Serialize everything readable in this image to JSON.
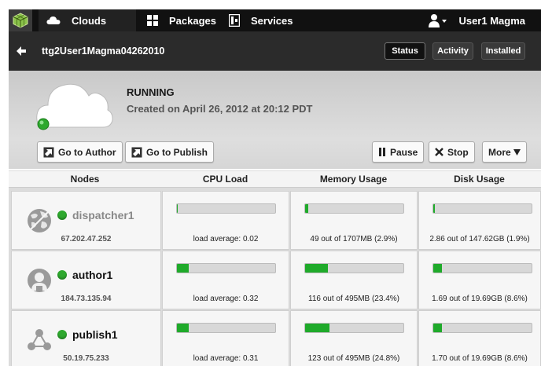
{
  "nav": {
    "tabs": [
      {
        "label": "Clouds",
        "icon": "cloud-icon"
      },
      {
        "label": "Packages",
        "icon": "grid-icon"
      },
      {
        "label": "Services",
        "icon": "services-icon"
      }
    ],
    "user": {
      "label": "User1 Magma",
      "icon": "user-icon"
    }
  },
  "instance": {
    "name": "ttg2User1Magma04262010",
    "views": [
      "Status",
      "Activity",
      "Installed"
    ],
    "active_view": "Status"
  },
  "status": {
    "state": "RUNNING",
    "created": "Created on April 26, 2012 at 20:12 PDT",
    "indicator_color": "#2ea82e"
  },
  "actions": {
    "go_author": "Go to Author",
    "go_publish": "Go to Publish",
    "pause": "Pause",
    "stop": "Stop",
    "more": "More"
  },
  "table": {
    "headers": [
      "Nodes",
      "CPU Load",
      "Memory Usage",
      "Disk Usage"
    ],
    "rows": [
      {
        "name": "dispatcher1",
        "ip": "67.202.47.252",
        "icon": "globe-icon",
        "cpu": "load average: 0.02",
        "cpu_pct": 1,
        "memory": "49 out of 1707MB (2.9%)",
        "mem_pct": 2.9,
        "disk": "2.86 out of 147.62GB (1.9%)",
        "disk_pct": 1.9
      },
      {
        "name": "author1",
        "ip": "184.73.135.94",
        "icon": "author-icon",
        "cpu": "load average: 0.32",
        "cpu_pct": 12,
        "memory": "116 out of 495MB (23.4%)",
        "mem_pct": 23.4,
        "disk": "1.69 out of 19.69GB (8.6%)",
        "disk_pct": 8.6
      },
      {
        "name": "publish1",
        "ip": "50.19.75.233",
        "icon": "network-icon",
        "cpu": "load average: 0.31",
        "cpu_pct": 12,
        "memory": "123 out of 495MB (24.8%)",
        "mem_pct": 24.8,
        "disk": "1.70 out of 19.69GB (8.6%)",
        "disk_pct": 8.6
      }
    ]
  },
  "colors": {
    "accent_green": "#1faa2a",
    "nav_bg": "#111111"
  }
}
